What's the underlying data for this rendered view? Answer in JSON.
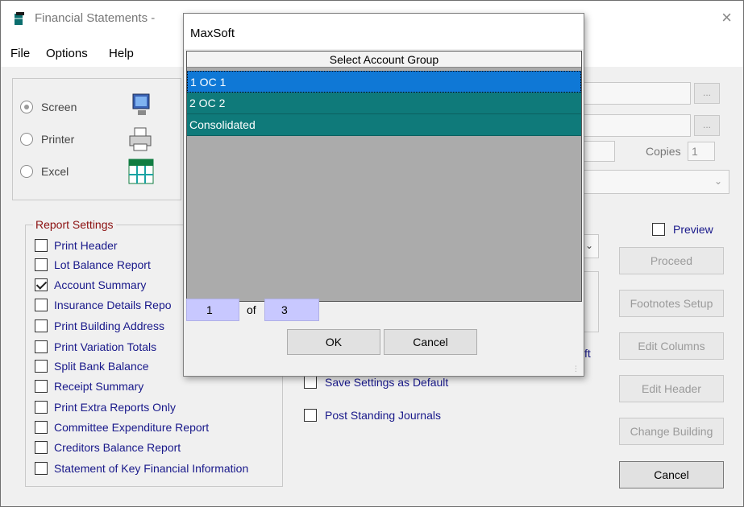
{
  "window": {
    "title": "Financial Statements -",
    "close_glyph": "×"
  },
  "menu": {
    "file": "File",
    "options": "Options",
    "help": "Help"
  },
  "output": {
    "screen_label": "Screen",
    "printer_label": "Printer",
    "excel_label": "Excel",
    "selected": "Screen"
  },
  "right_panel": {
    "copies_label": "Copies",
    "copies_value": "1",
    "ellipsis": "...",
    "preview_label": "Preview",
    "partial_label": "ft"
  },
  "report_settings": {
    "legend": "Report Settings",
    "items": [
      {
        "label": "Print Header",
        "checked": false
      },
      {
        "label": "Lot Balance Report",
        "checked": false
      },
      {
        "label": "Account Summary",
        "checked": true
      },
      {
        "label": "Insurance Details Repo",
        "checked": false
      },
      {
        "label": "Print Building Address",
        "checked": false
      },
      {
        "label": "Print Variation Totals",
        "checked": false
      },
      {
        "label": "Split Bank Balance",
        "checked": false
      },
      {
        "label": "Receipt Summary",
        "checked": false
      },
      {
        "label": "Print Extra Reports Only",
        "checked": false
      },
      {
        "label": "Committee Expenditure Report",
        "checked": false
      },
      {
        "label": "Creditors Balance Report",
        "checked": false
      },
      {
        "label": "Statement of Key Financial Information",
        "checked": false
      }
    ]
  },
  "middle_options": {
    "save_settings": "Save Settings as Default",
    "post_standing": "Post Standing Journals"
  },
  "side_buttons": {
    "proceed": "Proceed",
    "footnotes": "Footnotes Setup",
    "edit_columns": "Edit Columns",
    "edit_header": "Edit Header",
    "change_building": "Change Building",
    "cancel": "Cancel"
  },
  "modal": {
    "title": "MaxSoft",
    "grid_header": "Select Account Group",
    "rows": [
      {
        "label": "1  OC 1",
        "selected": true
      },
      {
        "label": "2  OC 2",
        "selected": false
      },
      {
        "label": "Consolidated",
        "selected": false
      }
    ],
    "nav_current": "1",
    "nav_of": "of",
    "nav_total": "3",
    "ok": "OK",
    "cancel": "Cancel"
  },
  "colors": {
    "row_teal": "#0f7a7a",
    "row_selected": "#0f78d6",
    "label_blue": "#18188a",
    "legend_red": "#8b1010"
  }
}
